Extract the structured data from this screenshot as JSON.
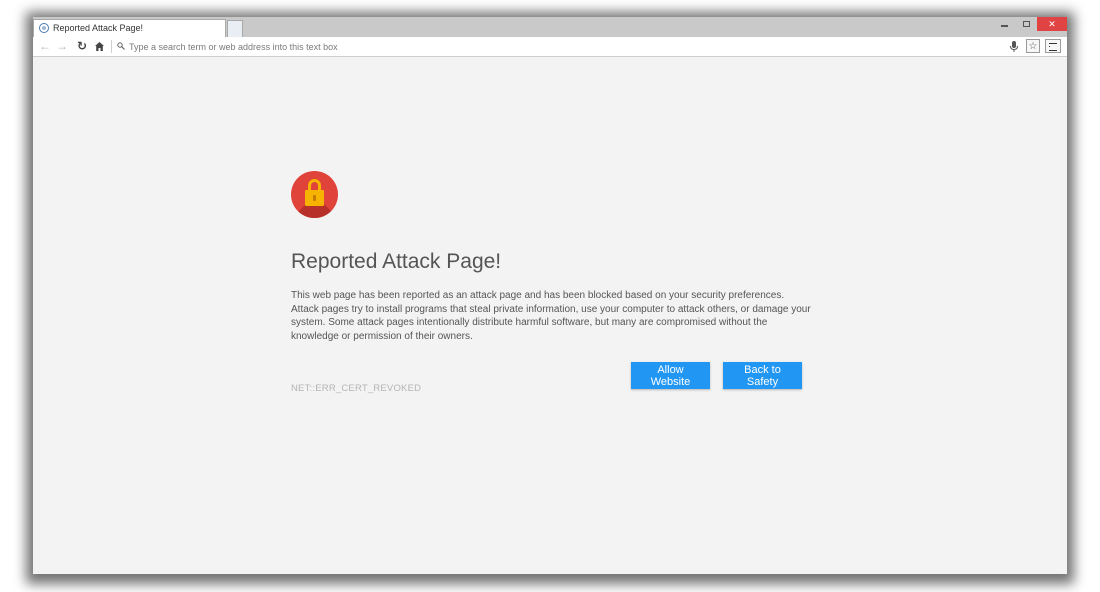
{
  "browser": {
    "tab": {
      "title": "Reported Attack Page!"
    },
    "window_controls": {
      "minimize": "",
      "maximize": "",
      "close": "✕"
    },
    "toolbar": {
      "address_placeholder": "Type a search term or web address into this text box",
      "address_value": ""
    }
  },
  "page": {
    "heading": "Reported Attack Page!",
    "body": "This web page has been reported as an attack page and has been blocked based on your security preferences. Attack pages try to install programs that steal private information, use your computer to attack others, or damage your system. Some attack pages intentionally distribute harmful software, but many are compromised without the knowledge or permission of their owners.",
    "error_code": "NET::ERR_CERT_REVOKED",
    "buttons": {
      "allow": "Allow Website",
      "safety": "Back to Safety"
    }
  },
  "colors": {
    "accent_button": "#2196f3",
    "lock_circle": "#e0433a",
    "lock_padlock": "#f6b400",
    "close_button": "#e04343"
  },
  "icons": [
    "globe-icon",
    "back-arrow-icon",
    "forward-arrow-icon",
    "reload-icon",
    "home-icon",
    "search-icon",
    "microphone-icon",
    "star-icon",
    "menu-icon",
    "lock-icon"
  ]
}
